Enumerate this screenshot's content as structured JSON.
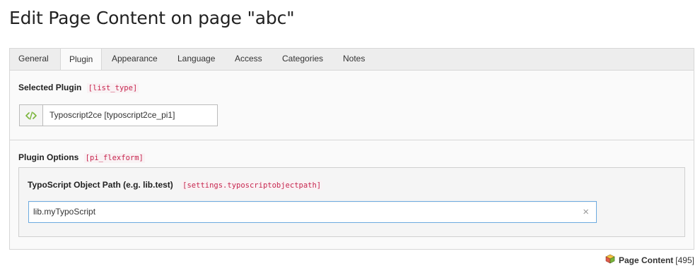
{
  "page": {
    "title": "Edit Page Content on page \"abc\""
  },
  "tabs": [
    {
      "label": "General",
      "active": false
    },
    {
      "label": "Plugin",
      "active": true
    },
    {
      "label": "Appearance",
      "active": false
    },
    {
      "label": "Language",
      "active": false
    },
    {
      "label": "Access",
      "active": false
    },
    {
      "label": "Categories",
      "active": false
    },
    {
      "label": "Notes",
      "active": false
    }
  ],
  "selected_plugin": {
    "label": "Selected Plugin",
    "field": "[list_type]",
    "value": "Typoscript2ce [typoscript2ce_pi1]",
    "icon": "code-brackets-icon"
  },
  "plugin_options": {
    "label": "Plugin Options",
    "field": "[pi_flexform]",
    "typoscript_path": {
      "label": "TypoScript Object Path (e.g. lib.test)",
      "field": "[settings.typoscriptobjectpath]",
      "value": "lib.myTypoScript",
      "clear_symbol": "×"
    }
  },
  "footer": {
    "icon": "content-cube-icon",
    "record_type": "Page Content",
    "record_id": "[495]"
  },
  "colors": {
    "code_text": "#c7254e",
    "input_focus_border": "#6daae0",
    "icon_green": "#7ab53b"
  }
}
